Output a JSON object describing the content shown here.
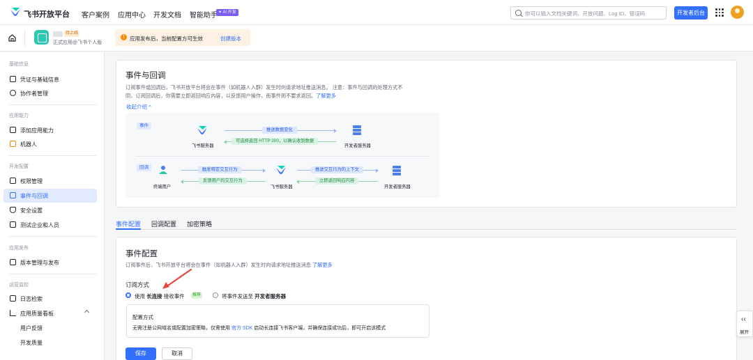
{
  "topnav": {
    "brand": "飞书开放平台",
    "links": [
      "客户案例",
      "应用中心",
      "开发文档",
      "智能助手"
    ],
    "ai_badge": "✦ AI 开发",
    "search_placeholder": "你可以输入文档关键词、开放问题、Log ID、错误码",
    "dev_console_button": "开发者后台"
  },
  "app_header": {
    "status_tag": "待上线",
    "subtitle": "正式应用@飞书个人版",
    "notice_text": "应用发布后，当前配置方可生效",
    "notice_link": "创建版本"
  },
  "sidebar": {
    "sections": [
      {
        "title": "基础信息",
        "items": [
          "凭证与基础信息",
          "协作者管理"
        ]
      },
      {
        "title": "应用能力",
        "items": [
          "添加应用能力",
          "机器人"
        ]
      },
      {
        "title": "开发配置",
        "items": [
          "权限管理",
          "事件与回调",
          "安全设置",
          "测试企业和人员"
        ]
      },
      {
        "title": "应用发布",
        "items": [
          "版本管理与发布"
        ]
      },
      {
        "title": "运营监控",
        "items": [
          "日志检索",
          "应用质量看板",
          "用户反馈",
          "开发质量"
        ]
      }
    ],
    "active": "事件与回调"
  },
  "intro_card": {
    "title": "事件与回调",
    "desc_line1": "订阅事件或回调后，飞书开放平台将会在事件（如机器人入群）发生时向请求地址推送消息。 注意：事件与回调的处理方式不",
    "desc_line2": "同，订阅回调后，你需要立即返回响应内容，以反馈用户操作，而事件则不要求返回。",
    "learn_more": "了解更多",
    "collapse": "收起介绍 ^",
    "diagram": {
      "event_tag": "事件",
      "callback_tag": "回调",
      "feishu_server": "飞书服务器",
      "dev_server": "开发者服务器",
      "end_user": "终端用户",
      "push_data": "推送数据变化",
      "return_200": "可选择返回 HTTP 200，以确认收到数据",
      "trigger": "触发特定交互行为",
      "feedback": "反馈用户的交互行为",
      "push_context": "推送交互行为的上下文",
      "return_now": "立即返回响应内容"
    }
  },
  "tabs": [
    "事件配置",
    "回调配置",
    "加密策略"
  ],
  "event_config": {
    "title": "事件配置",
    "desc": "订阅事件后，飞书开放平台将会在事件（如机器人入群）发生时向请求地址推送消息",
    "learn_more": "了解更多",
    "subscribe_label": "订阅方式",
    "option1_pre": "使用",
    "option1_bold": "长连接",
    "option1_post": "接收事件",
    "recommend": "推荐",
    "option2_pre": "将事件发送至",
    "option2_bold": "开发者服务器",
    "cfg_title": "配置方式",
    "cfg_desc_pre": "无需注册公网域名或配置加密策略，仅需使用",
    "cfg_desc_link": "官方 SDK",
    "cfg_desc_post": "启动长连接飞书客户端，并确保连接成功后，即可开启该模式",
    "save": "保存",
    "cancel": "取消"
  },
  "expand_panel": {
    "label": "展开",
    "chevron": "‹‹"
  }
}
